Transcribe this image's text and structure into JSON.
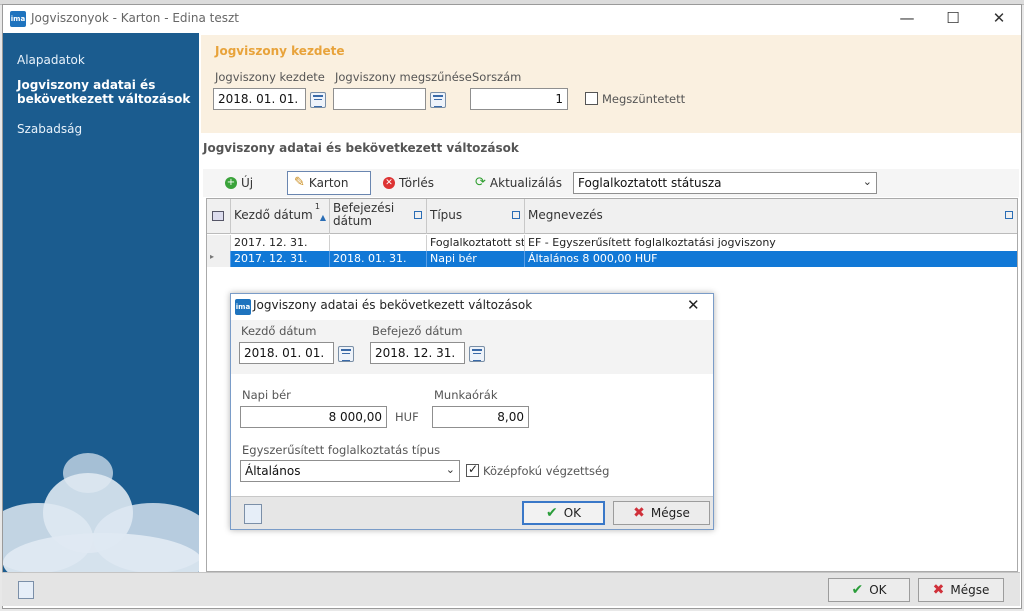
{
  "window": {
    "title": "Jogviszonyok - Karton - Edina teszt",
    "app_icon_text": "ima"
  },
  "sidebar": {
    "items": [
      {
        "label": "Alapadatok"
      },
      {
        "label": "Jogviszony adatai és bekövetkezett változások"
      },
      {
        "label": "Szabadság"
      }
    ]
  },
  "header": {
    "title": "Jogviszony kezdete",
    "start_label": "Jogviszony kezdete",
    "start_value": "2018. 01. 01.",
    "end_label": "Jogviszony megszűnése",
    "end_value": "",
    "serial_label": "Sorszám",
    "serial_value": "1",
    "terminated_label": "Megszüntetett"
  },
  "section": {
    "title": "Jogviszony adatai és bekövetkezett változások",
    "toolbar": {
      "new_label": "Új",
      "card_label": "Karton",
      "delete_label": "Törlés",
      "refresh_label": "Aktualizálás",
      "filter_value": "Foglalkoztatott státusza"
    },
    "grid": {
      "sort_indicator": "1",
      "headers": [
        "Kezdő dátum",
        "Befejezési dátum",
        "Típus",
        "Megnevezés"
      ],
      "rows": [
        {
          "start": "2017. 12. 31.",
          "end": "",
          "type": "Foglalkoztatott státusza",
          "name": "EF - Egyszerűsített foglalkoztatási jogviszony"
        },
        {
          "start": "2017. 12. 31.",
          "end": "2018. 01. 31.",
          "type": "Napi bér",
          "name": "Általános 8 000,00 HUF"
        }
      ]
    }
  },
  "dialog": {
    "title": "Jogviszony adatai és bekövetkezett változások",
    "start_label": "Kezdő dátum",
    "start_value": "2018. 01. 01.",
    "end_label": "Befejező dátum",
    "end_value": "2018. 12. 31.",
    "wage_label": "Napi bér",
    "wage_value": "8 000,00",
    "currency": "HUF",
    "hours_label": "Munkaórák",
    "hours_value": "8,00",
    "type_label": "Egyszerűsített foglalkoztatás típus",
    "type_value": "Általános",
    "secondary_label": "Középfokú végzettség",
    "secondary_checked": true,
    "ok_label": "OK",
    "cancel_label": "Mégse"
  },
  "footer": {
    "ok_label": "OK",
    "cancel_label": "Mégse"
  },
  "colors": {
    "sidebar": "#1b5c8f",
    "accent_orange": "#e8a33b",
    "selection": "#1178d6"
  }
}
